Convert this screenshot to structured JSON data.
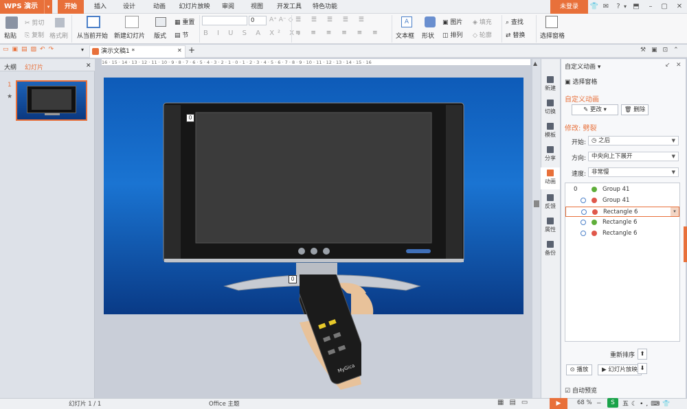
{
  "app": {
    "menu_label": "WPS 演示",
    "login": "未登录"
  },
  "tabs": [
    "开始",
    "插入",
    "设计",
    "动画",
    "幻灯片放映",
    "审阅",
    "视图",
    "开发工具",
    "特色功能"
  ],
  "ribbon": {
    "paste": "粘贴",
    "cut": "剪切",
    "copy": "复制",
    "format_painter": "格式刷",
    "from_current": "从当前开始",
    "new_slide": "新建幻灯片",
    "layout": "版式",
    "reset": "重置",
    "section": "节",
    "font_size": "0",
    "textbox": "文本框",
    "shape": "形状",
    "picture": "图片",
    "arrange": "排列",
    "fill": "填充",
    "outline": "轮廓",
    "find": "查找",
    "replace": "替换",
    "select_pane": "选择窗格"
  },
  "doc_tab": "演示文稿1 *",
  "left_pane": {
    "tab_outline": "大纲",
    "tab_slides": "幻灯片",
    "slide_number": "1"
  },
  "ruler_text": "16 · 15 · 14 · 13 · 12 · 11 · 10 · 9 · 8 · 7 · 6 · 5 · 4 · 3 · 2 · 1 · 0 · 1 · 2 · 3 · 4 · 5 · 6 · 7 · 8 · 9 · 10 · 11 · 12 · 13 · 14 · 15 · 16",
  "slide": {
    "tag_tv": "0",
    "tag_remote": "0",
    "remote_brand": "MyGica"
  },
  "right_nav": [
    "新建",
    "切换",
    "模板",
    "分享",
    "动画",
    "反馈",
    "属性",
    "备份"
  ],
  "panel": {
    "title": "自定义动画",
    "select_pane": "选择窗格",
    "section": "自定义动画",
    "change_btn": "更改",
    "delete_btn": "删除",
    "modify_label": "修改: 劈裂",
    "start_label": "开始:",
    "start_value": "之后",
    "direction_label": "方向:",
    "direction_value": "中央向上下展开",
    "speed_label": "速度:",
    "speed_value": "非常慢",
    "items": [
      {
        "num": "0",
        "name": "Group 41",
        "color": "#5fae3a"
      },
      {
        "num": "",
        "name": "Group 41",
        "color": "#e0574a"
      },
      {
        "num": "",
        "name": "Rectangle 6",
        "color": "#e0574a"
      },
      {
        "num": "",
        "name": "Rectangle 6",
        "color": "#5fae3a"
      },
      {
        "num": "",
        "name": "Rectangle 6",
        "color": "#e0574a"
      }
    ],
    "reorder": "重新排序",
    "play": "播放",
    "slideshow": "幻灯片放映",
    "autopreview": "自动预览"
  },
  "status": {
    "slide_info": "幻灯片 1 / 1",
    "theme": "Office 主题",
    "zoom": "68 %"
  }
}
